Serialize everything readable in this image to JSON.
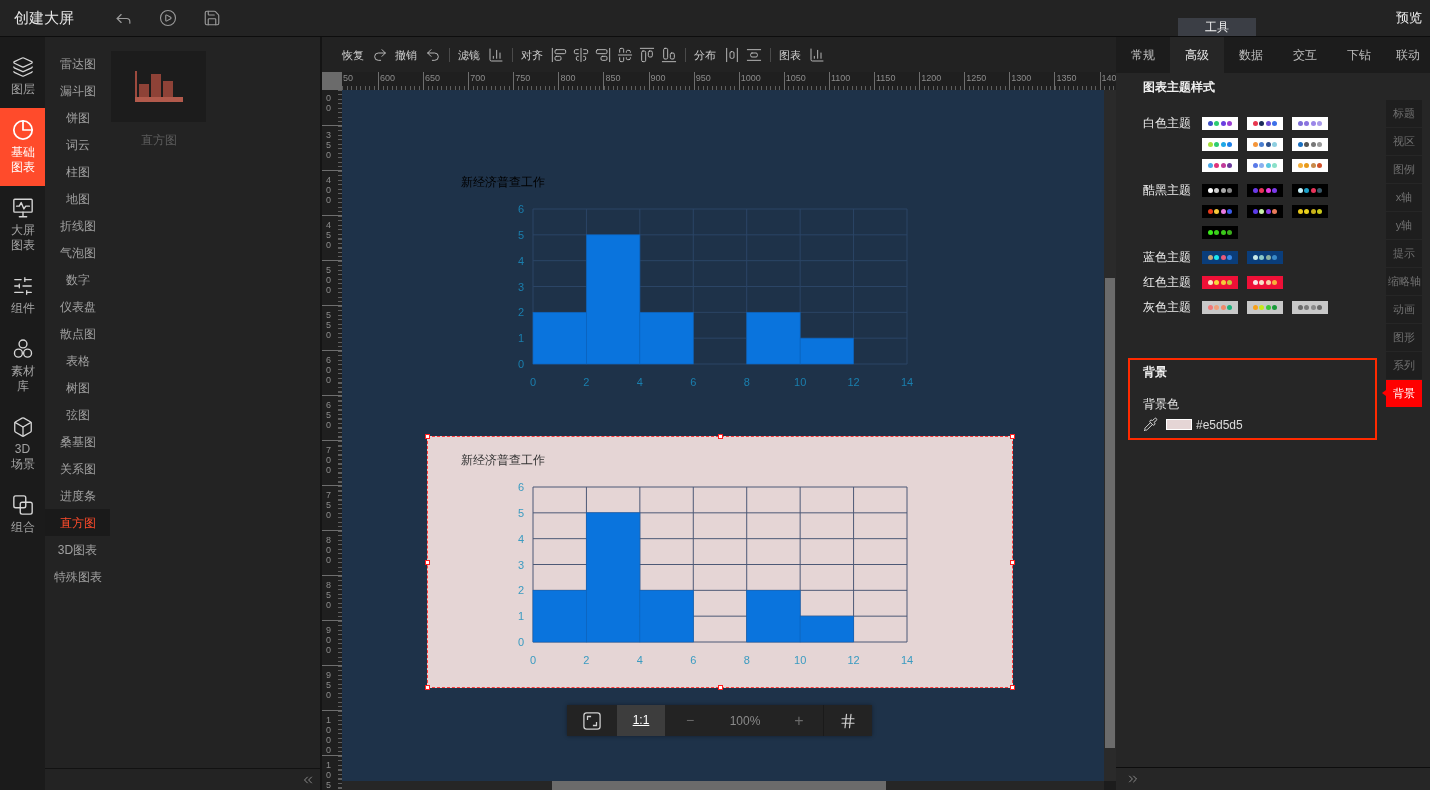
{
  "top_bar": {
    "title": "创建大屏",
    "panel_tab": "工具",
    "preview_button": "预览"
  },
  "nav_rail": [
    {
      "label": "图层",
      "selected": false
    },
    {
      "label": "基础图表",
      "selected": true
    },
    {
      "label": "大屏图表",
      "selected": false
    },
    {
      "label": "组件",
      "selected": false
    },
    {
      "label": "素材库",
      "selected": false
    },
    {
      "label": "3D场景",
      "selected": false
    },
    {
      "label": "组合",
      "selected": false
    }
  ],
  "chart_types": [
    {
      "label": "雷达图",
      "selected": false
    },
    {
      "label": "漏斗图",
      "selected": false
    },
    {
      "label": "饼图",
      "selected": false
    },
    {
      "label": "词云",
      "selected": false
    },
    {
      "label": "柱图",
      "selected": false
    },
    {
      "label": "地图",
      "selected": false
    },
    {
      "label": "折线图",
      "selected": false
    },
    {
      "label": "气泡图",
      "selected": false
    },
    {
      "label": "数字",
      "selected": false
    },
    {
      "label": "仪表盘",
      "selected": false
    },
    {
      "label": "散点图",
      "selected": false
    },
    {
      "label": "表格",
      "selected": false
    },
    {
      "label": "树图",
      "selected": false
    },
    {
      "label": "弦图",
      "selected": false
    },
    {
      "label": "桑基图",
      "selected": false
    },
    {
      "label": "关系图",
      "selected": false
    },
    {
      "label": "进度条",
      "selected": false
    },
    {
      "label": "直方图",
      "selected": true
    },
    {
      "label": "3D图表",
      "selected": false
    },
    {
      "label": "特殊图表",
      "selected": false
    }
  ],
  "thumbnail": {
    "label": "直方图"
  },
  "toolbar": [
    {
      "label": "恢复"
    },
    {
      "label": "撤销"
    },
    {
      "label": "滤镜"
    },
    {
      "label": "对齐"
    },
    {
      "label": "分布"
    },
    {
      "label": "图表"
    }
  ],
  "ruler": {
    "horizontal": [
      "50",
      "600",
      "650",
      "700",
      "750",
      "800",
      "850",
      "900",
      "950",
      "1000",
      "1050",
      "1100",
      "1150",
      "1200",
      "1250",
      "1300",
      "1350",
      "140"
    ],
    "vertical": [
      "00",
      "350",
      "400",
      "450",
      "500",
      "550",
      "600",
      "650",
      "700",
      "750",
      "800",
      "850",
      "900",
      "950",
      "1000",
      "105"
    ]
  },
  "charts": [
    {
      "selected": false,
      "chart_data": {
        "type": "bar",
        "title": "新经济普查工作",
        "x": [
          1,
          3,
          5,
          7,
          9,
          11,
          13
        ],
        "values": [
          2,
          5,
          2,
          0,
          2,
          1,
          0
        ],
        "xlim": [
          0,
          14
        ],
        "ylim": [
          0,
          6
        ],
        "xticks": [
          0,
          2,
          4,
          6,
          8,
          10,
          12,
          14
        ],
        "yticks": [
          0,
          1,
          2,
          3,
          4,
          5,
          6
        ],
        "grid": true
      }
    },
    {
      "selected": true,
      "color": "#e5d5d5",
      "chart_data": {
        "type": "bar",
        "title": "新经济普查工作",
        "x": [
          1,
          3,
          5,
          7,
          9,
          11,
          13
        ],
        "values": [
          2,
          5,
          2,
          0,
          2,
          1,
          0
        ],
        "xlim": [
          0,
          14
        ],
        "ylim": [
          0,
          6
        ],
        "xticks": [
          0,
          2,
          4,
          6,
          8,
          10,
          12,
          14
        ],
        "yticks": [
          0,
          1,
          2,
          3,
          4,
          5,
          6
        ],
        "grid": true
      }
    }
  ],
  "zoom_bar": {
    "actual_size": {
      "label": "1:1",
      "selected": true
    },
    "zoom_out": "−",
    "zoom_level": "100%",
    "zoom_in": "+"
  },
  "property_tabs": [
    {
      "label": "常规",
      "selected": false
    },
    {
      "label": "高级",
      "selected": true
    },
    {
      "label": "数据",
      "selected": false
    },
    {
      "label": "交互",
      "selected": false
    },
    {
      "label": "下钻",
      "selected": false
    },
    {
      "label": "联动",
      "selected": false
    }
  ],
  "theme_styles": {
    "title": "图表主题样式",
    "groups": [
      {
        "label": "白色主题",
        "swatches": [
          {
            "color": "#ffffff",
            "dots": [
              {
                "color": "#3f51c8"
              },
              {
                "color": "#2ecc71"
              },
              {
                "color": "#6a3ee0"
              },
              {
                "color": "#9c3fd1"
              }
            ]
          },
          {
            "color": "#ffffff",
            "dots": [
              {
                "color": "#e8374f"
              },
              {
                "color": "#1a2a5a"
              },
              {
                "color": "#6f4fd8"
              },
              {
                "color": "#3c6fe8"
              }
            ]
          },
          {
            "color": "#ffffff",
            "dots": [
              {
                "color": "#7e6fd8"
              },
              {
                "color": "#8a73e0"
              },
              {
                "color": "#9b86e8"
              },
              {
                "color": "#a99ae8"
              }
            ]
          },
          {
            "color": "#ffffff",
            "dots": [
              {
                "color": "#a8e03a"
              },
              {
                "color": "#2ecc71"
              },
              {
                "color": "#1ea7e6"
              },
              {
                "color": "#1e7fe6"
              }
            ]
          },
          {
            "color": "#ffffff",
            "dots": [
              {
                "color": "#f5963a"
              },
              {
                "color": "#4a7fd0"
              },
              {
                "color": "#2e4f8a"
              },
              {
                "color": "#8ecfe0"
              }
            ]
          },
          {
            "color": "#ffffff",
            "dots": [
              {
                "color": "#1a6fc0"
              },
              {
                "color": "#555555"
              },
              {
                "color": "#777777"
              },
              {
                "color": "#999999"
              }
            ]
          },
          {
            "color": "#ffffff",
            "dots": [
              {
                "color": "#4aa8e8"
              },
              {
                "color": "#e0347a"
              },
              {
                "color": "#c03a9a"
              },
              {
                "color": "#6a3a9a"
              }
            ]
          },
          {
            "color": "#ffffff",
            "dots": [
              {
                "color": "#5a7ae8"
              },
              {
                "color": "#8ab0f0"
              },
              {
                "color": "#5ac8e0"
              },
              {
                "color": "#8ae0c8"
              }
            ]
          },
          {
            "color": "#ffffff",
            "dots": [
              {
                "color": "#f5b03a"
              },
              {
                "color": "#e89a1a"
              },
              {
                "color": "#c88a4a"
              },
              {
                "color": "#d0502a"
              }
            ]
          }
        ]
      },
      {
        "label": "酷黑主题",
        "swatches": [
          {
            "color": "#000000",
            "dots": [
              {
                "color": "#ffffff"
              },
              {
                "color": "#cccccc"
              },
              {
                "color": "#aaaaaa"
              },
              {
                "color": "#888888"
              }
            ]
          },
          {
            "color": "#000000",
            "dots": [
              {
                "color": "#6a3ae8"
              },
              {
                "color": "#e8345a"
              },
              {
                "color": "#e83ae0"
              },
              {
                "color": "#7a3ae8"
              }
            ]
          },
          {
            "color": "#000000",
            "dots": [
              {
                "color": "#c8f0f8"
              },
              {
                "color": "#1aa0c8"
              },
              {
                "color": "#e8345a"
              },
              {
                "color": "#3a5a6a"
              }
            ]
          },
          {
            "color": "#000000",
            "dots": [
              {
                "color": "#e83a1a"
              },
              {
                "color": "#f5c83a"
              },
              {
                "color": "#e87ae0"
              },
              {
                "color": "#3a5ae8"
              }
            ]
          },
          {
            "color": "#000000",
            "dots": [
              {
                "color": "#5a3ae8"
              },
              {
                "color": "#c8f0a8"
              },
              {
                "color": "#8a3ae8"
              },
              {
                "color": "#e87a5a"
              }
            ]
          },
          {
            "color": "#000000",
            "dots": [
              {
                "color": "#e8c81a"
              },
              {
                "color": "#e8d01a"
              },
              {
                "color": "#c8b01a"
              },
              {
                "color": "#c8c81a"
              }
            ]
          },
          {
            "color": "#000000",
            "dots": [
              {
                "color": "#3ae81a"
              },
              {
                "color": "#3ad01a"
              },
              {
                "color": "#3ac81a"
              },
              {
                "color": "#3ab01a"
              }
            ]
          }
        ]
      },
      {
        "label": "蓝色主题",
        "swatches": [
          {
            "color": "#0a3d7a",
            "dots": [
              {
                "color": "#c8a87a"
              },
              {
                "color": "#1ae8f0"
              },
              {
                "color": "#e85a7a"
              },
              {
                "color": "#3a8ae8"
              }
            ]
          },
          {
            "color": "#0a3d7a",
            "dots": [
              {
                "color": "#c8e8e8"
              },
              {
                "color": "#8ac8c8"
              },
              {
                "color": "#8ab0a0"
              },
              {
                "color": "#3a8ac8"
              }
            ]
          }
        ]
      },
      {
        "label": "红色主题",
        "swatches": [
          {
            "color": "#ee1037",
            "dots": [
              {
                "color": "#f8e8c8"
              },
              {
                "color": "#f8d83a"
              },
              {
                "color": "#f8c83a"
              },
              {
                "color": "#c8c83a"
              }
            ]
          },
          {
            "color": "#ee1037",
            "dots": [
              {
                "color": "#f8e8e8"
              },
              {
                "color": "#f8e0c8"
              },
              {
                "color": "#f8d0a8"
              },
              {
                "color": "#f8b03a"
              }
            ]
          }
        ]
      },
      {
        "label": "灰色主题",
        "swatches": [
          {
            "color": "#c8c8c8",
            "dots": [
              {
                "color": "#f07a7a"
              },
              {
                "color": "#f0a07a"
              },
              {
                "color": "#f08a6a"
              },
              {
                "color": "#1ab07a"
              }
            ]
          },
          {
            "color": "#c8c8c8",
            "dots": [
              {
                "color": "#f8a01a"
              },
              {
                "color": "#c8e81a"
              },
              {
                "color": "#3ac83a"
              },
              {
                "color": "#1a9a3a"
              }
            ]
          },
          {
            "color": "#c8c8c8",
            "dots": [
              {
                "color": "#6a6a6a"
              },
              {
                "color": "#7a7a7a"
              },
              {
                "color": "#8a8a8a"
              },
              {
                "color": "#6a6a6a"
              }
            ]
          }
        ]
      }
    ]
  },
  "section_nav": [
    {
      "label": "标题",
      "selected": false
    },
    {
      "label": "视区",
      "selected": false
    },
    {
      "label": "图例",
      "selected": false
    },
    {
      "label": "x轴",
      "selected": false
    },
    {
      "label": "y轴",
      "selected": false
    },
    {
      "label": "提示",
      "selected": false
    },
    {
      "label": "缩略轴",
      "selected": false
    },
    {
      "label": "动画",
      "selected": false
    },
    {
      "label": "图形",
      "selected": false
    },
    {
      "label": "系列",
      "selected": false
    },
    {
      "label": "背景",
      "selected": true
    }
  ],
  "background": {
    "title": "背景",
    "highlighted": true,
    "field_label": "背景色",
    "color": "#e5d5d5",
    "value": "#e5d5d5"
  }
}
